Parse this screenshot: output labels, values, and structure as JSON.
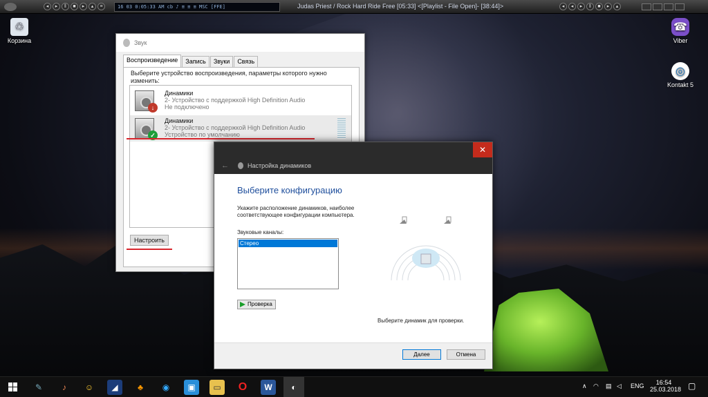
{
  "player": {
    "display_text": "16  03  0:05:33  AM cb ♪ ≡ ≡ ≡  MSC [FFE]",
    "now_playing": "Judas Priest / Rock Hard Ride Free  [05:33]   <[Playlist - File Open]- [38:44]>"
  },
  "desktop": {
    "icons": [
      {
        "label": "Корзина",
        "icon": "recycle-bin-icon"
      },
      {
        "label": "Viber",
        "icon": "viber-icon"
      },
      {
        "label": "Kontakt 5",
        "icon": "kontakt-icon"
      }
    ]
  },
  "sound_window": {
    "title": "Звук",
    "tabs": [
      "Воспроизведение",
      "Запись",
      "Звуки",
      "Связь"
    ],
    "instruction": "Выберите устройство воспроизведения, параметры которого нужно изменить:",
    "devices": [
      {
        "name": "Динамики",
        "desc": "2- Устройство с поддержкой High Definition Audio",
        "status": "Не подключено"
      },
      {
        "name": "Динамики",
        "desc": "2- Устройство с поддержкой High Definition Audio",
        "status": "Устройство по умолчанию"
      }
    ],
    "configure_button": "Настроить"
  },
  "speaker_setup": {
    "title": "Настройка динамиков",
    "close": "✕",
    "heading": "Выберите конфигурацию",
    "description": "Укажите расположение динамиков, наиболее соответствующее конфигурации компьютера.",
    "channels_label": "Звуковые каналы:",
    "channels": [
      "Стерео"
    ],
    "test_button": "Проверка",
    "hint": "Выберите динамик для проверки.",
    "next_button": "Далее",
    "cancel_button": "Отмена"
  },
  "taskbar": {
    "lang": "ENG",
    "time": "16:54",
    "date": "25.03.2018"
  },
  "colors": {
    "accent_blue": "#0078d7",
    "heading_blue": "#1e4e9c",
    "close_red": "#c42b1c",
    "annotation_red": "#d8242b"
  }
}
